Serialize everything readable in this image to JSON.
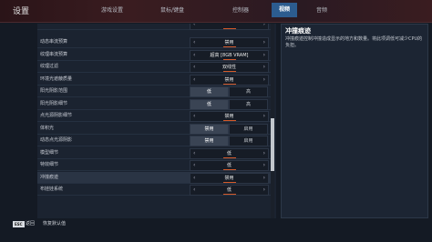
{
  "header": {
    "title": "设置",
    "tabs": [
      {
        "label": "游戏设置",
        "active": false
      },
      {
        "label": "鼠标/键盘",
        "active": false
      },
      {
        "label": "控制器",
        "active": false
      },
      {
        "label": "视频",
        "active": true
      },
      {
        "label": "音频",
        "active": false
      }
    ]
  },
  "settings": [
    {
      "label": "",
      "type": "stepper",
      "value": "",
      "partial": true
    },
    {
      "label": "动态串流预算",
      "type": "stepper",
      "value": "禁用"
    },
    {
      "label": "纹理串流预算",
      "type": "stepper",
      "value": "超高 [8GB VRAM]"
    },
    {
      "label": "纹理过滤",
      "type": "stepper",
      "value": "双线性"
    },
    {
      "label": "环境光遮蔽质量",
      "type": "stepper",
      "value": "禁用"
    },
    {
      "label": "阳光阴影范围",
      "type": "toggle",
      "options": [
        "低",
        "高"
      ],
      "selected": 0
    },
    {
      "label": "阳光阴影细节",
      "type": "toggle",
      "options": [
        "低",
        "高"
      ],
      "selected": 0
    },
    {
      "label": "点光源阴影细节",
      "type": "stepper",
      "value": "禁用"
    },
    {
      "label": "体积光",
      "type": "toggle",
      "options": [
        "禁用",
        "启用"
      ],
      "selected": 0
    },
    {
      "label": "动态点光源阴影",
      "type": "toggle",
      "options": [
        "禁用",
        "启用"
      ],
      "selected": 0
    },
    {
      "label": "模型细节",
      "type": "stepper",
      "value": "低"
    },
    {
      "label": "特效细节",
      "type": "stepper",
      "value": "低"
    },
    {
      "label": "冲撞痕迹",
      "type": "stepper",
      "value": "禁用",
      "highlight": true
    },
    {
      "label": "布娃娃系统",
      "type": "stepper",
      "value": "低"
    }
  ],
  "description": {
    "title": "冲撞痕迹",
    "text": "冲撞痕迹控制冲撞造成显示的地方和数量。将此项调低可减少CPU的负担。"
  },
  "footer": {
    "esc_key": "ESC",
    "back_label": "返回",
    "reset_label": "恢复默认值"
  }
}
